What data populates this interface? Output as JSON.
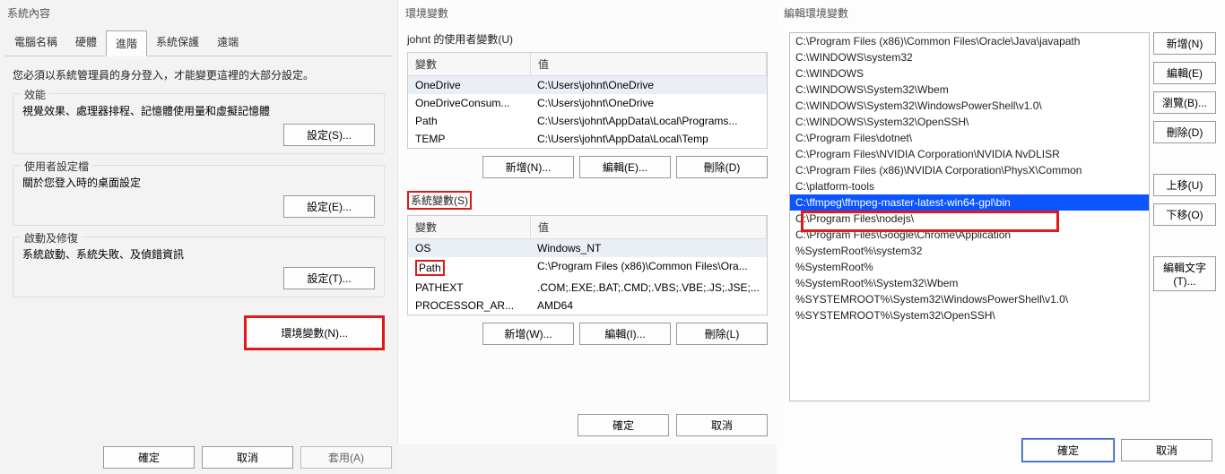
{
  "sysprops": {
    "title": "系統內容",
    "tabs": [
      "電腦名稱",
      "硬體",
      "進階",
      "系統保護",
      "遠端"
    ],
    "msg": "您必須以系統管理員的身分登入，才能變更這裡的大部分設定。",
    "perf": {
      "label": "效能",
      "desc": "視覺效果、處理器排程、記憶體使用量和虛擬記憶體",
      "btn": "設定(S)..."
    },
    "profile": {
      "label": "使用者設定檔",
      "desc": "關於您登入時的桌面設定",
      "btn": "設定(E)..."
    },
    "startup": {
      "label": "啟動及修復",
      "desc": "系統啟動、系統失敗、及偵錯資訊",
      "btn": "設定(T)..."
    },
    "env_btn": "環境變數(N)...",
    "ok": "確定",
    "cancel": "取消",
    "apply": "套用(A)"
  },
  "envvars": {
    "title": "環境變數",
    "user_label": "johnt 的使用者變數(U)",
    "headers": {
      "var": "變數",
      "val": "值"
    },
    "user_rows": [
      {
        "var": "OneDrive",
        "val": "C:\\Users\\johnt\\OneDrive"
      },
      {
        "var": "OneDriveConsum...",
        "val": "C:\\Users\\johnt\\OneDrive"
      },
      {
        "var": "Path",
        "val": "C:\\Users\\johnt\\AppData\\Local\\Programs..."
      },
      {
        "var": "TEMP",
        "val": "C:\\Users\\johnt\\AppData\\Local\\Temp"
      }
    ],
    "user_btns": {
      "new": "新增(N)...",
      "edit": "編輯(E)...",
      "del": "刪除(D)"
    },
    "sys_label": "系統變數(S)",
    "sys_rows": [
      {
        "var": "OS",
        "val": "Windows_NT"
      },
      {
        "var": "Path",
        "val": "C:\\Program Files (x86)\\Common Files\\Ora..."
      },
      {
        "var": "PATHEXT",
        "val": ".COM;.EXE;.BAT;.CMD;.VBS;.VBE;.JS;.JSE;..."
      },
      {
        "var": "PROCESSOR_AR...",
        "val": "AMD64"
      }
    ],
    "sys_btns": {
      "new": "新增(W)...",
      "edit": "編輯(I)...",
      "del": "刪除(L)"
    },
    "ok": "確定",
    "cancel": "取消"
  },
  "editpath": {
    "title": "編輯環境變數",
    "items": [
      "C:\\Program Files (x86)\\Common Files\\Oracle\\Java\\javapath",
      "C:\\WINDOWS\\system32",
      "C:\\WINDOWS",
      "C:\\WINDOWS\\System32\\Wbem",
      "C:\\WINDOWS\\System32\\WindowsPowerShell\\v1.0\\",
      "C:\\WINDOWS\\System32\\OpenSSH\\",
      "C:\\Program Files\\dotnet\\",
      "C:\\Program Files\\NVIDIA Corporation\\NVIDIA NvDLISR",
      "C:\\Program Files (x86)\\NVIDIA Corporation\\PhysX\\Common",
      "C:\\platform-tools",
      "C:\\ffmpeg\\ffmpeg-master-latest-win64-gpl\\bin",
      "C:\\Program Files\\nodejs\\",
      "C:\\Program Files\\Google\\Chrome\\Application",
      "%SystemRoot%\\system32",
      "%SystemRoot%",
      "%SystemRoot%\\System32\\Wbem",
      "%SYSTEMROOT%\\System32\\WindowsPowerShell\\v1.0\\",
      "%SYSTEMROOT%\\System32\\OpenSSH\\"
    ],
    "selected_index": 10,
    "btns": {
      "new": "新增(N)",
      "edit": "編輯(E)",
      "browse": "瀏覽(B)...",
      "del": "刪除(D)",
      "up": "上移(U)",
      "down": "下移(O)",
      "edit_text": "編輯文字(T)..."
    },
    "ok": "確定",
    "cancel": "取消"
  }
}
